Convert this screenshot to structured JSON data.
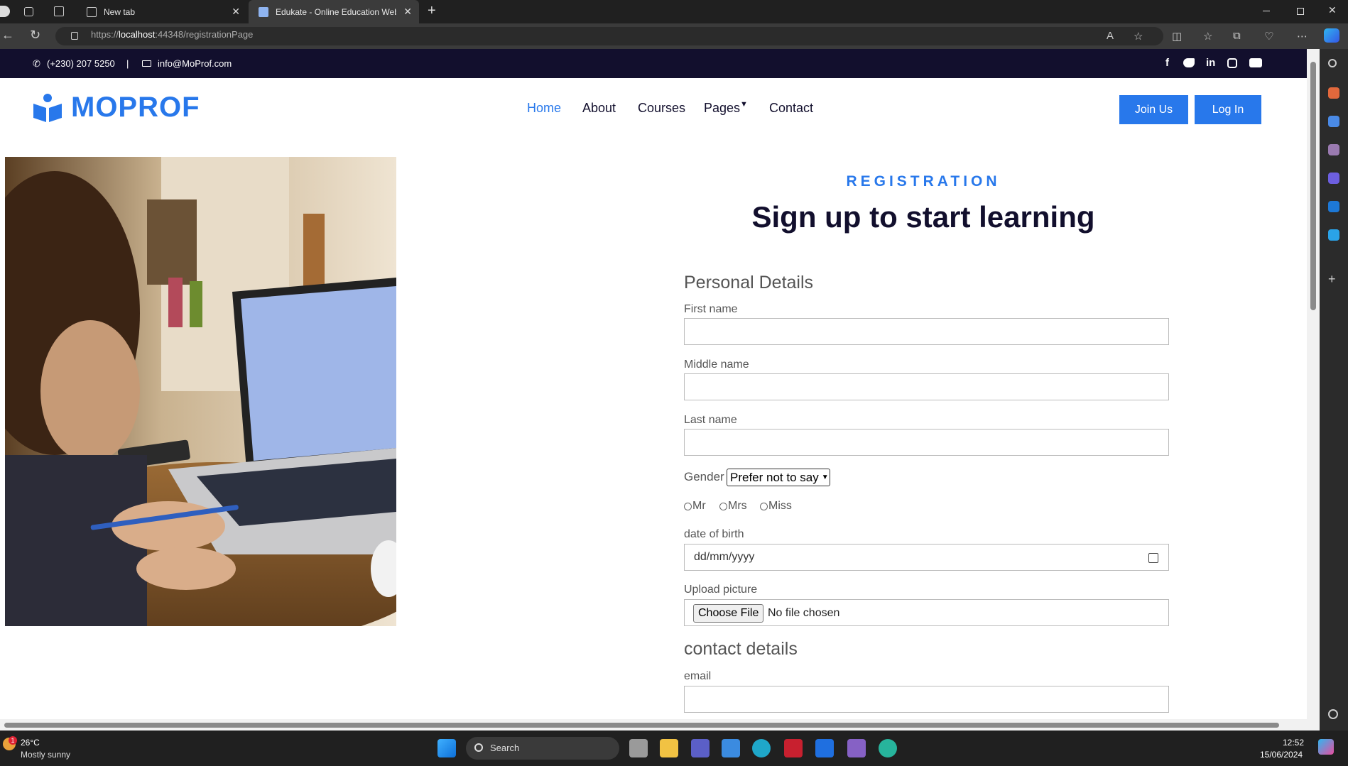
{
  "browser": {
    "tabs": [
      {
        "label": "New tab"
      },
      {
        "label": "Edukate - Online Education Web"
      }
    ],
    "url_prefix": "https://",
    "url_host": "localhost",
    "url_path": ":44348/registrationPage"
  },
  "topbar": {
    "phone": "(+230) 207 5250",
    "separator": "|",
    "email": "info@MoProf.com"
  },
  "navbar": {
    "logo": "MOPROF",
    "links": [
      "Home",
      "About",
      "Courses",
      "Pages",
      "Contact"
    ],
    "active": "Home",
    "join": "Join Us",
    "login": "Log In"
  },
  "form": {
    "eyebrow": "REGISTRATION",
    "title": "Sign up to start learning",
    "personal_heading": "Personal Details",
    "first_name_label": "First name",
    "middle_name_label": "Middle name",
    "last_name_label": "Last name",
    "gender_label": "Gender",
    "gender_value": "Prefer not to say",
    "titles": [
      "Mr",
      "Mrs",
      "Miss"
    ],
    "dob_label": "date of birth",
    "dob_placeholder": "dd/mm/yyyy",
    "upload_label": "Upload picture",
    "choose_file": "Choose File",
    "no_file": "No file chosen",
    "contact_heading": "contact details",
    "email_label": "email"
  },
  "taskbar": {
    "temp": "26°C",
    "weather": "Mostly sunny",
    "search": "Search",
    "time": "12:52",
    "date": "15/06/2024",
    "badge": "1"
  },
  "colors": {
    "brand": "#2878eb",
    "dark": "#120f2d"
  }
}
